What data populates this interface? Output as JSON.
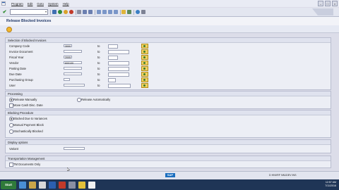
{
  "menu": {
    "items": [
      "Program",
      "Edit",
      "Goto",
      "System",
      "Help"
    ]
  },
  "title": "Release Blocked Invoices",
  "selection": {
    "header": "Selection of Blocked Invoices",
    "to_label": "to",
    "rows": [
      {
        "label": "Company Code",
        "value": "3000"
      },
      {
        "label": "Invoice Document",
        "value": ""
      },
      {
        "label": "Fiscal Year",
        "value": "2005"
      },
      {
        "label": "Vendor",
        "value": "600100"
      },
      {
        "label": "Posting Date",
        "value": ""
      },
      {
        "label": "Due Date",
        "value": ""
      },
      {
        "label": "Purchasing Group",
        "value": ""
      },
      {
        "label": "User",
        "value": ""
      }
    ]
  },
  "processing": {
    "header": "Processing",
    "release_manually": "Release Manually",
    "release_automatically": "Release Automatically",
    "move_cash_disc": "Move Cash Disc. Date"
  },
  "blocking": {
    "header": "Blocking Procedure",
    "options": [
      "Blocked Due to Variances",
      "Manual Payment Block",
      "Stochastically Blocked"
    ]
  },
  "display": {
    "header": "Display options",
    "variant_label": "Variant"
  },
  "transport": {
    "header": "Transportation Management",
    "tm_only": "TM Documents Only"
  },
  "status": {
    "brand": "SAP",
    "system_info": "D  HNVRF  NN1DEV  INS"
  },
  "taskbar": {
    "start": "Start",
    "time": "12:57 AM",
    "date": "7/11/2016"
  },
  "colors": {
    "title_text": "#233a6a",
    "taskbar": "#1f3556",
    "sap_blue": "#1b6fbf"
  }
}
